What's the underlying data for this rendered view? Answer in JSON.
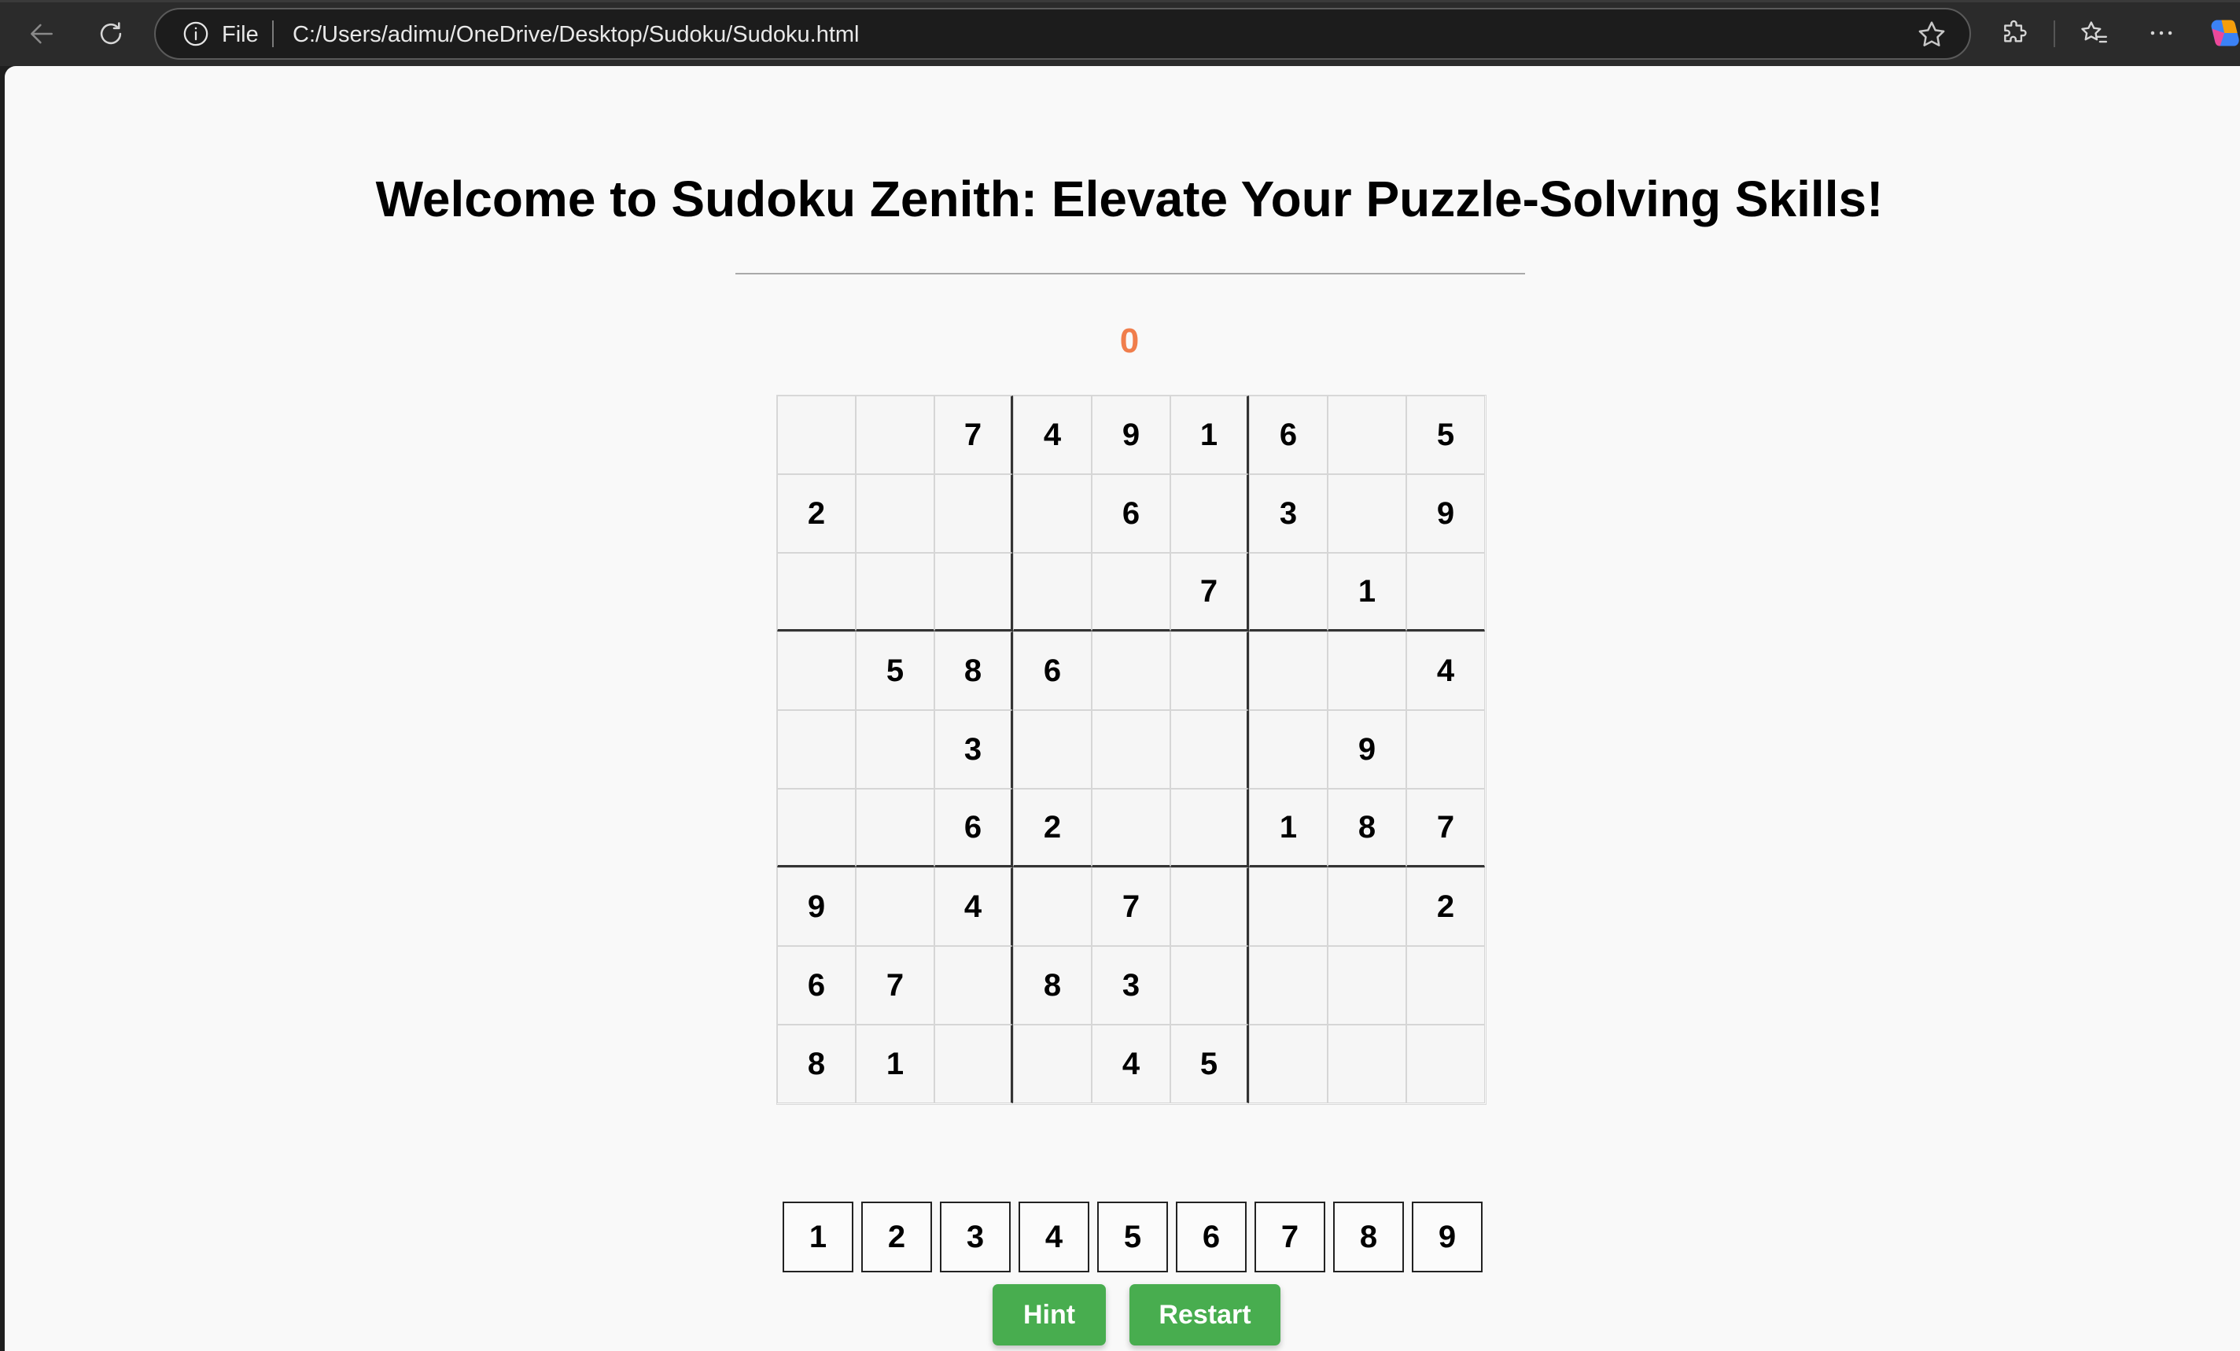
{
  "browser": {
    "file_label": "File",
    "url": "C:/Users/adimu/OneDrive/Desktop/Sudoku/Sudoku.html"
  },
  "page": {
    "title": "Welcome to Sudoku Zenith: Elevate Your Puzzle-Solving Skills!",
    "score": "0",
    "score_color": "#f07e4c"
  },
  "board": {
    "rows": [
      [
        "",
        "",
        "7",
        "4",
        "9",
        "1",
        "6",
        "",
        "5"
      ],
      [
        "2",
        "",
        "",
        "",
        "6",
        "",
        "3",
        "",
        "9"
      ],
      [
        "",
        "",
        "",
        "",
        "",
        "7",
        "",
        "1",
        ""
      ],
      [
        "",
        "5",
        "8",
        "6",
        "",
        "",
        "",
        "",
        "4"
      ],
      [
        "",
        "",
        "3",
        "",
        "",
        "",
        "",
        "9",
        ""
      ],
      [
        "",
        "",
        "6",
        "2",
        "",
        "",
        "1",
        "8",
        "7"
      ],
      [
        "9",
        "",
        "4",
        "",
        "7",
        "",
        "",
        "",
        "2"
      ],
      [
        "6",
        "7",
        "",
        "8",
        "3",
        "",
        "",
        "",
        ""
      ],
      [
        "8",
        "1",
        "",
        "",
        "4",
        "5",
        "",
        "",
        ""
      ]
    ]
  },
  "numpad": [
    "1",
    "2",
    "3",
    "4",
    "5",
    "6",
    "7",
    "8",
    "9"
  ],
  "actions": {
    "hint_label": "Hint",
    "restart_label": "Restart",
    "button_color": "#48ad4f"
  }
}
